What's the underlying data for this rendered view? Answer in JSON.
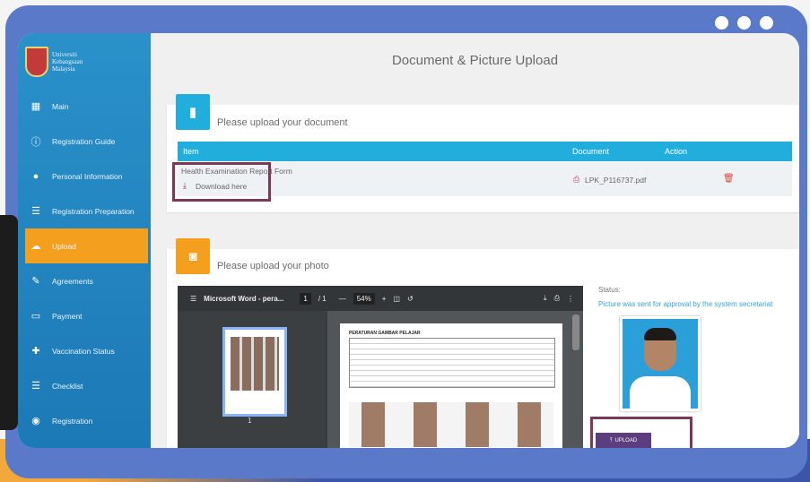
{
  "page": {
    "title": "Document & Picture Upload"
  },
  "sidebar": {
    "logo_lines": [
      "Universiti",
      "Kebangsaan",
      "Malaysia"
    ],
    "items": [
      {
        "label": "Main",
        "icon": "dashboard-icon"
      },
      {
        "label": "Registration Guide",
        "icon": "info-icon"
      },
      {
        "label": "Personal Information",
        "icon": "person-icon"
      },
      {
        "label": "Registration Preparation",
        "icon": "list-icon"
      },
      {
        "label": "Upload",
        "icon": "cloud-upload-icon",
        "active": true
      },
      {
        "label": "Agreements",
        "icon": "handshake-icon"
      },
      {
        "label": "Payment",
        "icon": "card-icon"
      },
      {
        "label": "Vaccination Status",
        "icon": "plus-icon"
      },
      {
        "label": "Checklist",
        "icon": "checklist-icon"
      },
      {
        "label": "Registration",
        "icon": "account-icon"
      }
    ]
  },
  "document": {
    "heading": "Please upload your document",
    "columns": {
      "item": "Item",
      "document": "Document",
      "action": "Action"
    },
    "row": {
      "item": "Health Examination Report Form",
      "download_label": "Download here",
      "file": "LPK_P116737.pdf"
    }
  },
  "photo": {
    "heading": "Please upload your photo",
    "viewer": {
      "filename": "Microsoft Word - pera...",
      "page": "1",
      "pages": "/ 1",
      "zoom": "54%",
      "thumb_page": "1",
      "doc_title": "PERATURAN GAMBAR PELAJAR"
    },
    "status_label": "Status:",
    "status_text": "Picture was sent for approval by the system secretariat",
    "upload_label": "UPLOAD"
  },
  "colors": {
    "sidebar": "#2a91c9",
    "accent_orange": "#f4a01e",
    "table_header": "#22aedd",
    "highlight": "#7a3a57",
    "upload_button": "#5b3d80"
  }
}
